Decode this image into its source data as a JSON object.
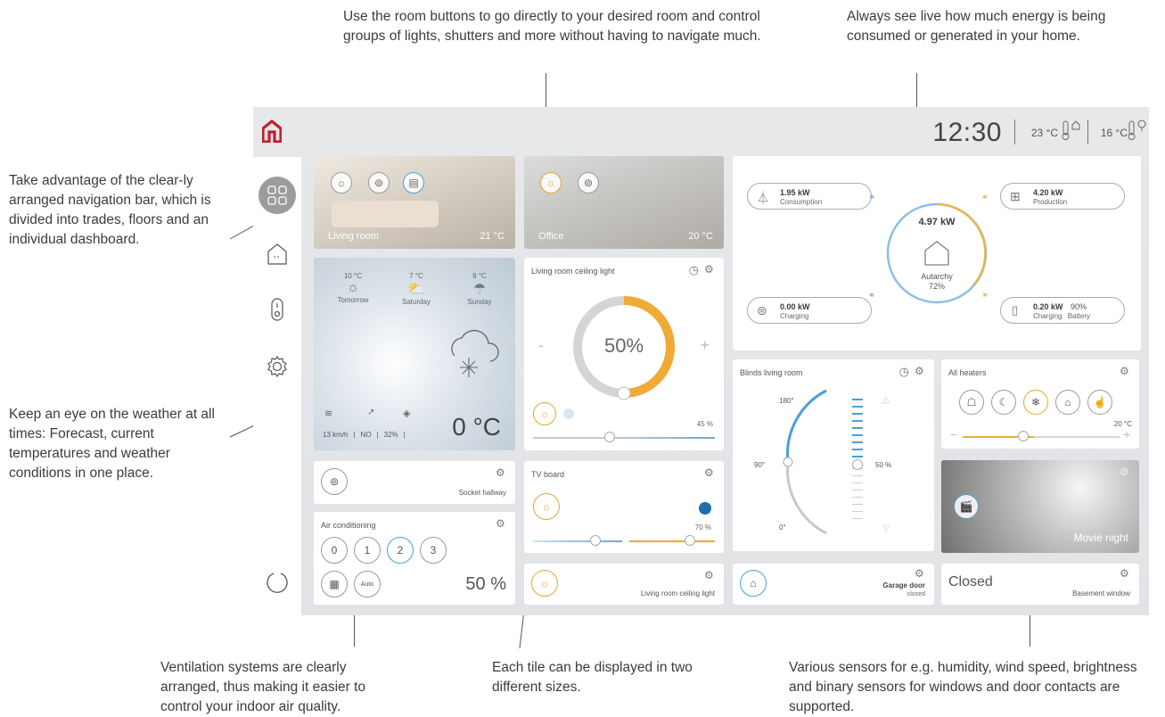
{
  "callouts": {
    "rooms": "Use the room buttons to go directly to your desired room and control groups of lights, shutters and more without having to navigate much.",
    "energy": "Always see live how much energy is being consumed or generated in your home.",
    "nav": "Take advantage of the clear-ly arranged navigation bar, which is divided into trades, floors and an individual dashboard.",
    "weather": "Keep an eye on the weather at all times: Forecast, current temperatures and weather conditions in one place.",
    "ventilation": "Ventilation systems are clearly arranged, thus making  it easier to control your indoor air quality.",
    "tiles": "Each tile can be displayed in two different sizes.",
    "sensors": "Various sensors for e.g. humidity, wind speed, brightness and binary sensors for windows and door contacts are supported."
  },
  "header": {
    "time": "12:30",
    "indoor_temp": "23 °C",
    "outdoor_temp": "16 °C",
    "accent": "#c0202f"
  },
  "rooms": [
    {
      "name": "Living room",
      "temp": "21 °C"
    },
    {
      "name": "Office",
      "temp": "20 °C"
    }
  ],
  "weather": {
    "forecast": [
      {
        "temp": "10 °C",
        "day": "Tomorrow"
      },
      {
        "temp": "7 °C",
        "day": "Saturday"
      },
      {
        "temp": "9 °C",
        "day": "Sunday"
      }
    ],
    "wind": "13 km/h",
    "direction": "NO",
    "humidity": "32%",
    "current": "0 °C"
  },
  "energy": {
    "consumption_value": "1.95 kW",
    "consumption_label": "Consumption",
    "production_value": "4.20 kW",
    "production_label": "Production",
    "charging_value": "0.00 kW",
    "charging_label": "Charging",
    "battery_value": "0.20 kW",
    "battery_pct": "90%",
    "battery_label1": "Charging",
    "battery_label2": "Battery",
    "center_value": "4.97 kW",
    "center_label": "Autarchy",
    "center_pct": "72%"
  },
  "ceiling_light": {
    "title": "Living room ceiling light",
    "percent": "50",
    "percent_sign": "%",
    "minus": "-",
    "plus": "+",
    "slider_label": "45 %",
    "level": 0.5
  },
  "blinds": {
    "title": "Blinds living room",
    "angle_top": "180°",
    "angle_mid": "90°",
    "angle_bottom": "0°",
    "position": "50 %"
  },
  "heaters": {
    "title": "All heaters",
    "temp": "20 °C"
  },
  "socket": {
    "label": "Socket hallway"
  },
  "tv": {
    "title": "TV board",
    "value": "70 %"
  },
  "movie": {
    "label": "Movie night"
  },
  "aircon": {
    "title": "Air conditioning",
    "levels": [
      "0",
      "1",
      "2",
      "3"
    ],
    "auto": "Auto",
    "percent": "50 %"
  },
  "ceiling_small": {
    "label": "Living room ceiling light"
  },
  "garage": {
    "title": "Garage door",
    "state": "closed"
  },
  "basement": {
    "state": "Closed",
    "label": "Basement window"
  }
}
